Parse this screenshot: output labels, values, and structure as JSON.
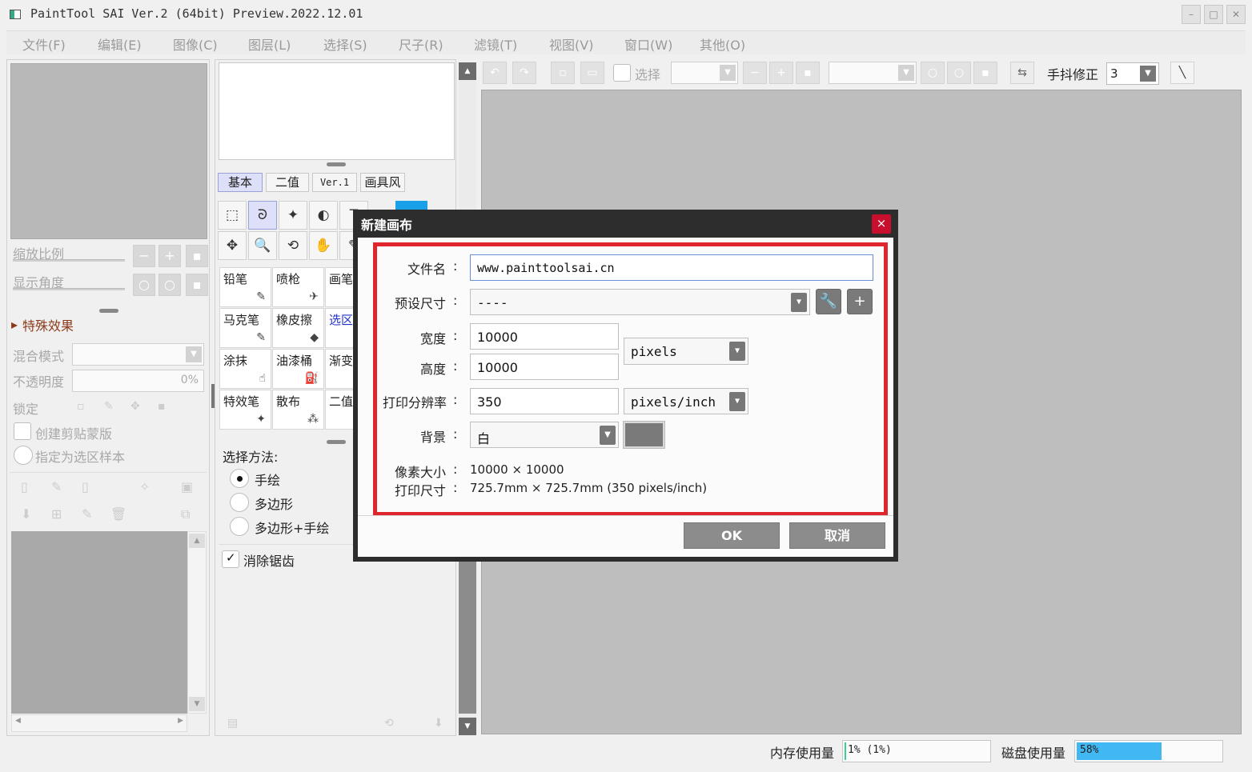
{
  "window": {
    "title": "PaintTool SAI Ver.2 (64bit) Preview.2022.12.01",
    "minimize": "–",
    "maximize": "□",
    "close": "✕"
  },
  "menu": [
    "文件(F)",
    "编辑(E)",
    "图像(C)",
    "图层(L)",
    "选择(S)",
    "尺子(R)",
    "滤镜(T)",
    "视图(V)",
    "窗口(W)",
    "其他(O)"
  ],
  "left_panel": {
    "zoom_label": "缩放比例",
    "rotation_label": "显示角度",
    "effects_label": "特殊效果",
    "blend_mode_label": "混合模式",
    "opacity_label": "不透明度",
    "opacity_value": "0%",
    "lock_label": "锁定",
    "clipping_label": "创建剪贴蒙版",
    "selection_source_label": "指定为选区样本"
  },
  "tool_panel": {
    "tabs": [
      "基本",
      "二值",
      "Ver.1",
      "画具风"
    ],
    "tools_row1": [
      "⬚",
      "ᘐ",
      "✦",
      "◐",
      "T"
    ],
    "tools_row2": [
      "✥",
      "🔍",
      "⟲",
      "✋",
      "✎"
    ],
    "brushes": [
      {
        "label": "铅笔",
        "icon": "✎"
      },
      {
        "label": "喷枪",
        "icon": "✈"
      },
      {
        "label": "画笔",
        "icon": ""
      },
      {
        "label": "马克笔",
        "icon": "✎"
      },
      {
        "label": "橡皮擦",
        "icon": "◆"
      },
      {
        "label": "选区笔",
        "icon": ""
      },
      {
        "label": "涂抹",
        "icon": "☝"
      },
      {
        "label": "油漆桶",
        "icon": "⛽"
      },
      {
        "label": "渐变",
        "icon": ""
      },
      {
        "label": "特效笔",
        "icon": "✦"
      },
      {
        "label": "散布",
        "icon": "⁂"
      },
      {
        "label": "二值笔",
        "icon": ""
      }
    ],
    "select_method_label": "选择方法:",
    "methods": [
      "手绘",
      "多边形",
      "多边形+手绘"
    ],
    "antialias_label": "消除锯齿"
  },
  "top_toolbar": {
    "select_label": "选择",
    "stabilizer_label": "手抖修正",
    "stabilizer_value": "3"
  },
  "status": {
    "memory_label": "内存使用量",
    "memory_value": "1% (1%)",
    "memory_percent": 1,
    "disk_label": "磁盘使用量",
    "disk_value": "58%",
    "disk_percent": 58
  },
  "dialog": {
    "title": "新建画布",
    "close": "×",
    "filename_label": "文件名",
    "filename_value": "www.painttoolsai.cn",
    "preset_label": "预设尺寸",
    "preset_value": "----",
    "width_label": "宽度",
    "width_value": "10000",
    "height_label": "高度",
    "height_value": "10000",
    "size_unit": "pixels",
    "resolution_label": "打印分辨率",
    "resolution_value": "350",
    "resolution_unit": "pixels/inch",
    "background_label": "背景",
    "background_value": "白",
    "colon": ":",
    "pixel_size_label": "像素大小",
    "pixel_size_value": "10000 × 10000",
    "print_size_label": "打印尺寸",
    "print_size_value": "725.7mm × 725.7mm (350 pixels/inch)",
    "ok": "OK",
    "cancel": "取消",
    "highlight_color": "#e0262d"
  }
}
